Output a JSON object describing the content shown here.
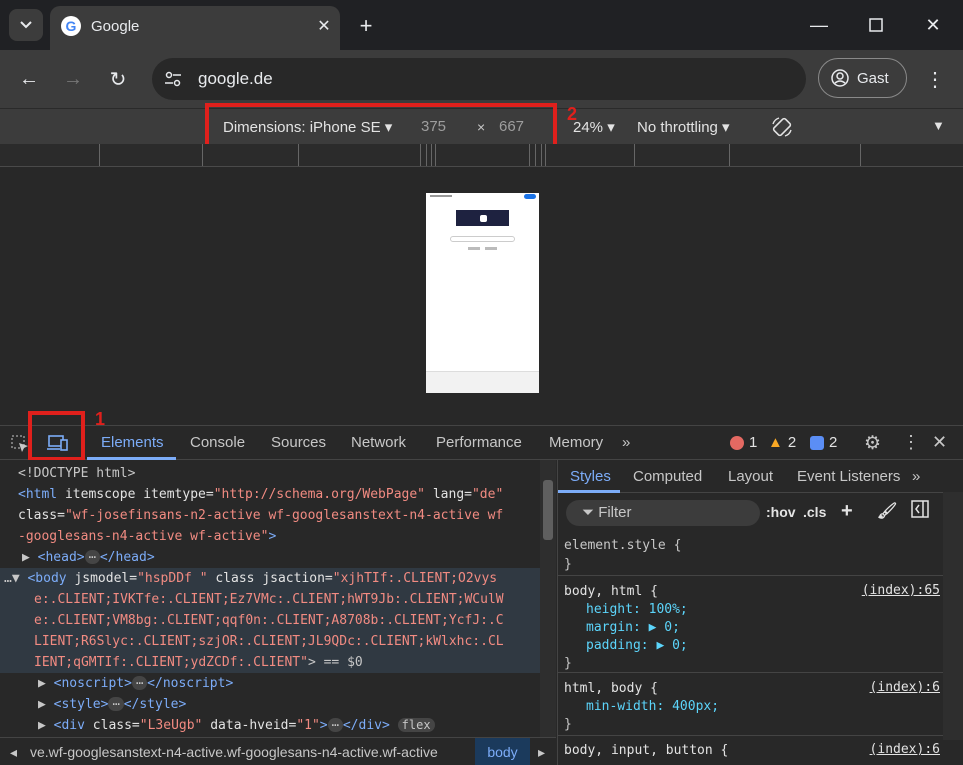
{
  "browser": {
    "tab_title": "Google",
    "favicon": "G",
    "url": "google.de",
    "profile_label": "Gast"
  },
  "device_toolbar": {
    "dimensions_label": "Dimensions: iPhone SE",
    "width": "375",
    "times": "×",
    "height": "667",
    "zoom": "24%",
    "throttling": "No throttling"
  },
  "annotations": {
    "one": "1",
    "two": "2"
  },
  "devtools": {
    "tabs": [
      "Elements",
      "Console",
      "Sources",
      "Network",
      "Performance",
      "Memory"
    ],
    "errors": "1",
    "warnings": "2",
    "messages": "2",
    "breadcrumb_path": "ve.wf-googlesanstext-n4-active.wf-googlesans-n4-active.wf-active",
    "breadcrumb_current": "body"
  },
  "styles": {
    "tabs": [
      "Styles",
      "Computed",
      "Layout",
      "Event Listeners"
    ],
    "filter_placeholder": "Filter",
    "hov": ":hov",
    "cls": ".cls",
    "rule1_selector": "element.style {",
    "rule1_close": "}",
    "rule2_selector": "body, html {",
    "rule2_source": "(index):65",
    "rule2_p1": "height: 100%;",
    "rule2_p2": "margin: ▶ 0;",
    "rule2_p3": "padding: ▶ 0;",
    "rule2_close": "}",
    "rule3_selector": "html, body {",
    "rule3_source": "(index):6",
    "rule3_p1": "min-width: 400px;",
    "rule3_close": "}",
    "rule4_selector": "body, input, button {",
    "rule4_source": "(index):6"
  },
  "dom_lines": {
    "l1": "<!DOCTYPE html>",
    "l2a": "<html ",
    "l2b": "itemscope itemtype=",
    "l2c": "\"http://schema.org/WebPage\"",
    "l2d": " lang=",
    "l2e": "\"de\"",
    "l3a": "class=",
    "l3b": "\"wf-josefinsans-n2-active wf-googlesanstext-n4-active wf",
    "l4a": "-googlesans-n4-active wf-active\"",
    "l4b": ">",
    "l5": "<head>",
    "l5b": "</head>",
    "l6a": "<body ",
    "l6b": "jsmodel=",
    "l6c": "\"hspDDf \"",
    "l6d": " class jsaction=",
    "l6e": "\"xjhTIf:.CLIENT;O2vys",
    "l7": "e:.CLIENT;IVKTfe:.CLIENT;Ez7VMc:.CLIENT;hWT9Jb:.CLIENT;WCulW",
    "l8": "e:.CLIENT;VM8bg:.CLIENT;qqf0n:.CLIENT;A8708b:.CLIENT;YcfJ:.C",
    "l9": "LIENT;R6Slyc:.CLIENT;szjOR:.CLIENT;JL9QDc:.CLIENT;kWlxhc:.CL",
    "l10a": "IENT;qGMTIf:.CLIENT;ydZCDf:.CLIENT\"",
    "l10b": "> == $0",
    "l11": "<noscript>",
    "l11b": "</noscript>",
    "l12": "<style>",
    "l12b": "</style>",
    "l13a": "<div ",
    "l13b": "class=",
    "l13c": "\"L3eUgb\"",
    "l13d": " data-hveid=",
    "l13e": "\"1\"",
    "l13f": ">",
    "l13g": "</div>",
    "flex": "flex",
    "ellipsis": "⋯"
  }
}
